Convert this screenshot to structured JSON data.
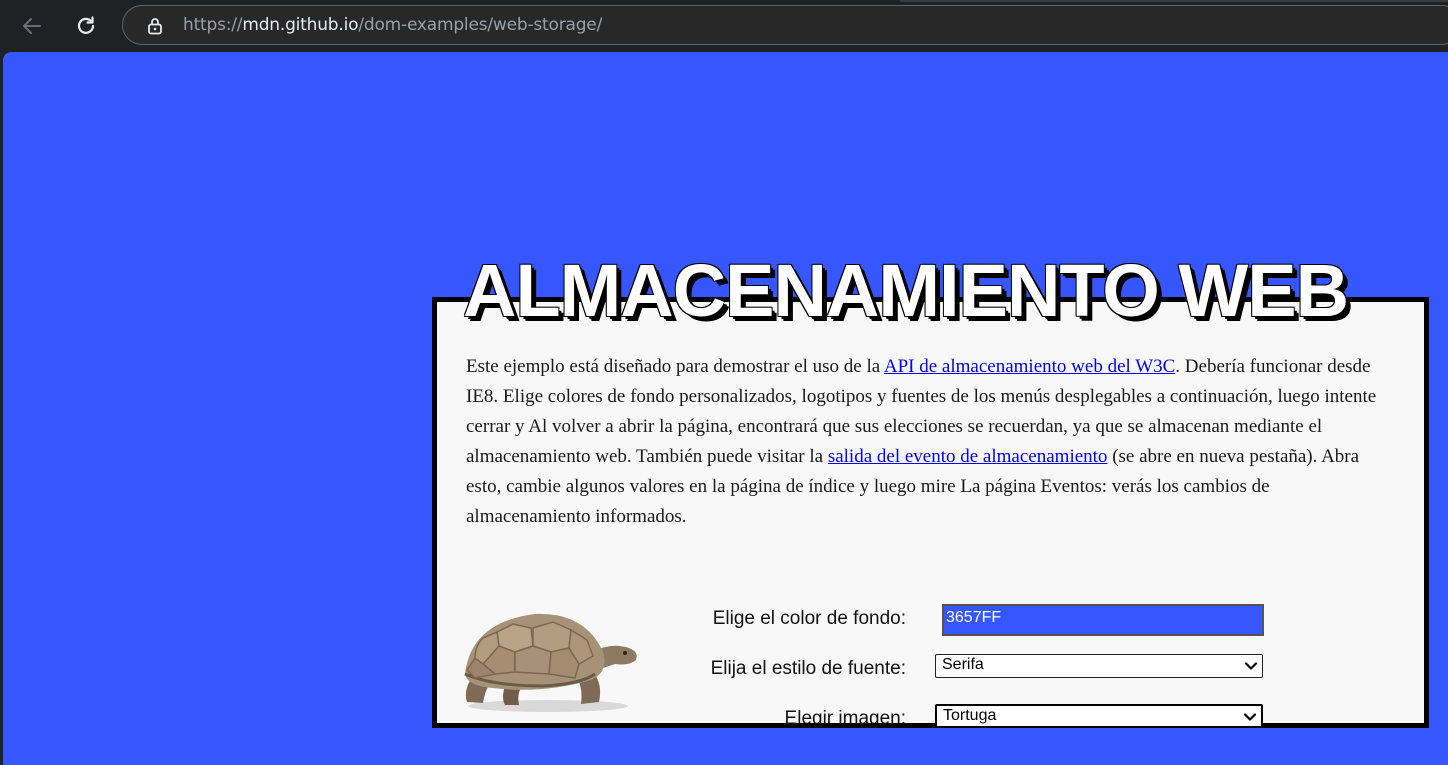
{
  "browser": {
    "url_scheme": "https://",
    "url_host": "mdn.github.io",
    "url_path": "/dom-examples/web-storage/"
  },
  "page": {
    "background_color": "#3657FF",
    "title": "ALMACENAMIENTO WEB",
    "intro": {
      "text_1": "Este ejemplo está diseñado para demostrar el uso de la ",
      "link_1": "API de almacenamiento web del W3C",
      "text_2": ". Debería funcionar desde IE8. Elige colores de fondo personalizados, logotipos y fuentes de los menús desplegables a continuación, luego intente cerrar y Al volver a abrir la página, encontrará que sus elecciones se recuerdan, ya que se almacenan mediante el almacenamiento web. También puede visitar la ",
      "link_2": "salida del evento de almacenamiento",
      "text_3": " (se abre en nueva pestaña). Abra esto, cambie algunos valores en la página de índice y luego mire La página Eventos: verás los cambios de almacenamiento informados."
    },
    "form": {
      "bg_color_label": "Elige el color de fondo:",
      "bg_color_value": "3657FF",
      "font_label": "Elija el estilo de fuente:",
      "font_value": "Serifa",
      "image_label": "Elegir imagen:",
      "image_value": "Tortuga"
    },
    "image_icon": "turtle-image"
  }
}
